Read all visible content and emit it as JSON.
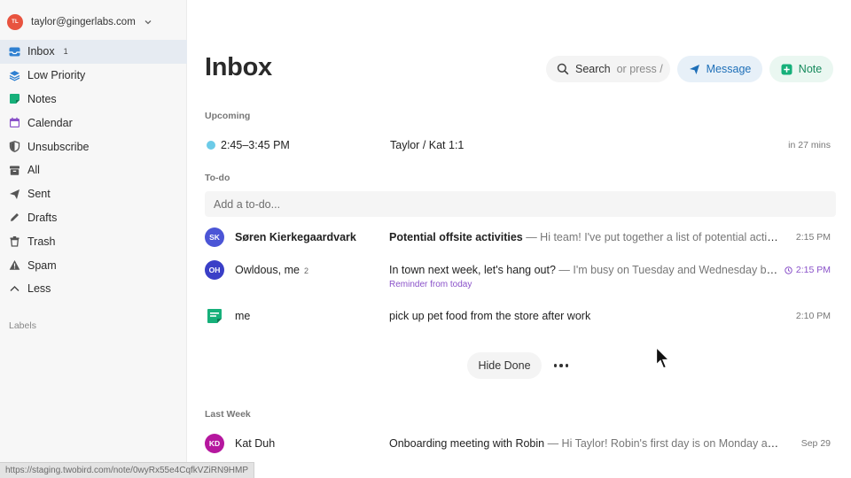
{
  "account": {
    "initials": "TL",
    "email": "taylor@gingerlabs.com",
    "avatar_color": "#e8533f"
  },
  "sidebar": {
    "items": [
      {
        "label": "Inbox",
        "badge": "1",
        "icon": "inbox-icon",
        "active": true,
        "color": "#2f80d1"
      },
      {
        "label": "Low Priority",
        "badge": "",
        "icon": "layers-icon",
        "color": "#2f80d1"
      },
      {
        "label": "Notes",
        "badge": "",
        "icon": "notes-icon",
        "color": "#16b07a"
      },
      {
        "label": "Calendar",
        "badge": "",
        "icon": "calendar-icon",
        "color": "#8a52c9"
      },
      {
        "label": "Unsubscribe",
        "badge": "",
        "icon": "shield-icon",
        "color": "#555555"
      },
      {
        "label": "All",
        "badge": "",
        "icon": "archive-icon",
        "color": "#555555"
      },
      {
        "label": "Sent",
        "badge": "",
        "icon": "send-icon",
        "color": "#555555"
      },
      {
        "label": "Drafts",
        "badge": "",
        "icon": "pencil-icon",
        "color": "#555555"
      },
      {
        "label": "Trash",
        "badge": "",
        "icon": "trash-icon",
        "color": "#555555"
      },
      {
        "label": "Spam",
        "badge": "",
        "icon": "warning-icon",
        "color": "#555555"
      },
      {
        "label": "Less",
        "badge": "",
        "icon": "chevron-up-icon",
        "color": "#555555"
      }
    ],
    "labels_heading": "Labels"
  },
  "status_url": "https://staging.twobird.com/note/0wyRx55e4CqfkVZiRN9HMP",
  "header": {
    "title": "Inbox",
    "search_label": "Search",
    "search_hint": "or press /",
    "message_label": "Message",
    "note_label": "Note"
  },
  "upcoming": {
    "heading": "Upcoming",
    "event": {
      "time": "2:45–3:45 PM",
      "title": "Taylor / Kat 1:1",
      "relative": "in 27 mins",
      "dot_color": "#6ccbe8"
    }
  },
  "todo": {
    "heading": "To-do",
    "placeholder": "Add a to-do...",
    "rows": [
      {
        "initials": "SK",
        "avatar_color": "#4b55d6",
        "sender": "Søren Kierkegaardvark",
        "count": "",
        "subject": "Potential offsite activities",
        "preview": " — Hi team! I've put together a list of potential activities for our offsite",
        "time": "2:15 PM",
        "bold": true
      },
      {
        "initials": "OH",
        "avatar_color": "#3a3fc7",
        "sender": "Owldous, me",
        "count": "2",
        "subject": "In town next week, let's hang out?",
        "preview": " — I'm busy on Tuesday and Wednesday but free the rest of the week",
        "time": "2:15 PM",
        "reminder": "Reminder from today",
        "bold": false
      },
      {
        "initials": "",
        "avatar_color": "#16b07a",
        "sender": "me",
        "count": "",
        "subject": "pick up pet food from the store after work",
        "preview": "",
        "time": "2:10 PM",
        "bold": false
      }
    ],
    "hide_done_label": "Hide Done"
  },
  "last_week": {
    "heading": "Last Week",
    "row": {
      "initials": "KD",
      "avatar_color": "#b5179e",
      "sender": "Kat Duh",
      "subject": "Onboarding meeting with Robin",
      "preview": " — Hi Taylor! Robin's first day is on Monday and we want to make sure she feels welcome",
      "time": "Sep 29"
    }
  }
}
